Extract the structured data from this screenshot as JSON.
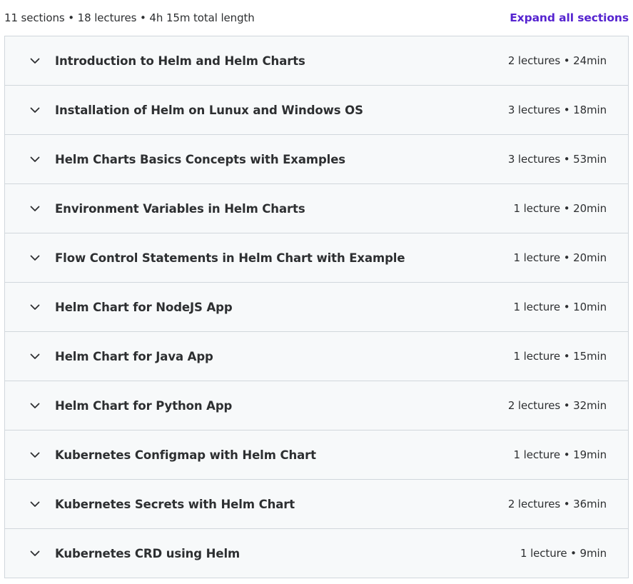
{
  "summary": {
    "text": "11 sections • 18 lectures • 4h 15m total length",
    "expand_label": "Expand all sections"
  },
  "colors": {
    "accent": "#5624d0",
    "row_background": "#f7f9fa",
    "border": "#d1d7dc",
    "text": "#2d2f31"
  },
  "icons": {
    "section_toggle": "chevron-down-icon"
  },
  "sections": [
    {
      "title": "Introduction to Helm and Helm Charts",
      "meta": "2 lectures • 24min"
    },
    {
      "title": "Installation of Helm on Lunux and Windows OS",
      "meta": "3 lectures • 18min"
    },
    {
      "title": "Helm Charts Basics Concepts with Examples",
      "meta": "3 lectures • 53min"
    },
    {
      "title": "Environment Variables in Helm Charts",
      "meta": "1 lecture • 20min"
    },
    {
      "title": "Flow Control Statements in Helm Chart with Example",
      "meta": "1 lecture • 20min"
    },
    {
      "title": "Helm Chart for NodeJS App",
      "meta": "1 lecture • 10min"
    },
    {
      "title": "Helm Chart for Java App",
      "meta": "1 lecture • 15min"
    },
    {
      "title": "Helm Chart for Python App",
      "meta": "2 lectures • 32min"
    },
    {
      "title": "Kubernetes Configmap with Helm Chart",
      "meta": "1 lecture • 19min"
    },
    {
      "title": "Kubernetes Secrets with Helm Chart",
      "meta": "2 lectures • 36min"
    },
    {
      "title": "Kubernetes CRD using Helm",
      "meta": "1 lecture • 9min"
    }
  ]
}
